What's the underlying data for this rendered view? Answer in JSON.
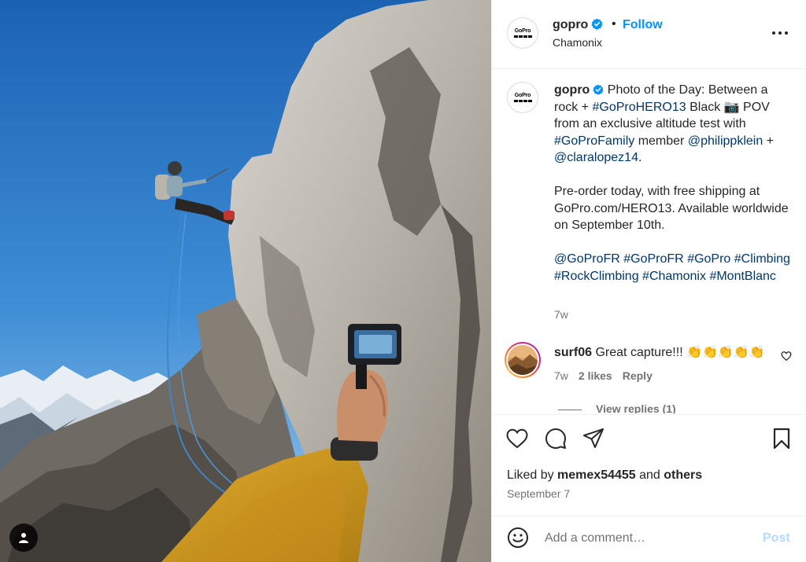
{
  "post": {
    "image_alt": "Climber rappelling on granite ridge above Chamonix glaciers while a hand holds a GoPro HERO13 camera"
  },
  "header": {
    "username": "gopro",
    "logo_text": "GoPro",
    "dot": "•",
    "follow_label": "Follow",
    "location": "Chamonix"
  },
  "caption": {
    "username": "gopro",
    "line1_text": " Photo of the Day: Between a rock + ",
    "tag_hero13": "#GoProHERO13",
    "line1_after": " Black 📷 POV from an exclusive altitude test with ",
    "tag_family": "#GoProFamily",
    "text_member": " member ",
    "mention_1": "@philippklein",
    "text_plus": " + ",
    "mention_2": "@claralopez14",
    "text_period": ".",
    "paragraph2": "Pre-order today, with free shipping at GoPro.com/HERO13. Available worldwide on September 10th.",
    "hashtags": [
      "@GoProFR",
      "#GoProFR",
      "#GoPro",
      "#Climbing",
      "#RockClimbing",
      "#Chamonix",
      "#MontBlanc"
    ],
    "time": "7w"
  },
  "comment": {
    "username": "surf06",
    "text": " Great capture!!! 👏👏👏👏👏",
    "time": "7w",
    "likes": "2 likes",
    "reply_label": "Reply",
    "view_replies": "View replies (1)"
  },
  "actions": {
    "liked_by_prefix": "Liked by ",
    "liked_by_user": "memex54455",
    "liked_by_and": " and ",
    "liked_by_others": "others",
    "date": "September 7"
  },
  "add_comment": {
    "placeholder": "Add a comment…",
    "post_label": "Post"
  },
  "colors": {
    "accent": "#0095f6",
    "link": "#00376b",
    "muted": "#737373",
    "post_disabled": "#b3dbff"
  }
}
